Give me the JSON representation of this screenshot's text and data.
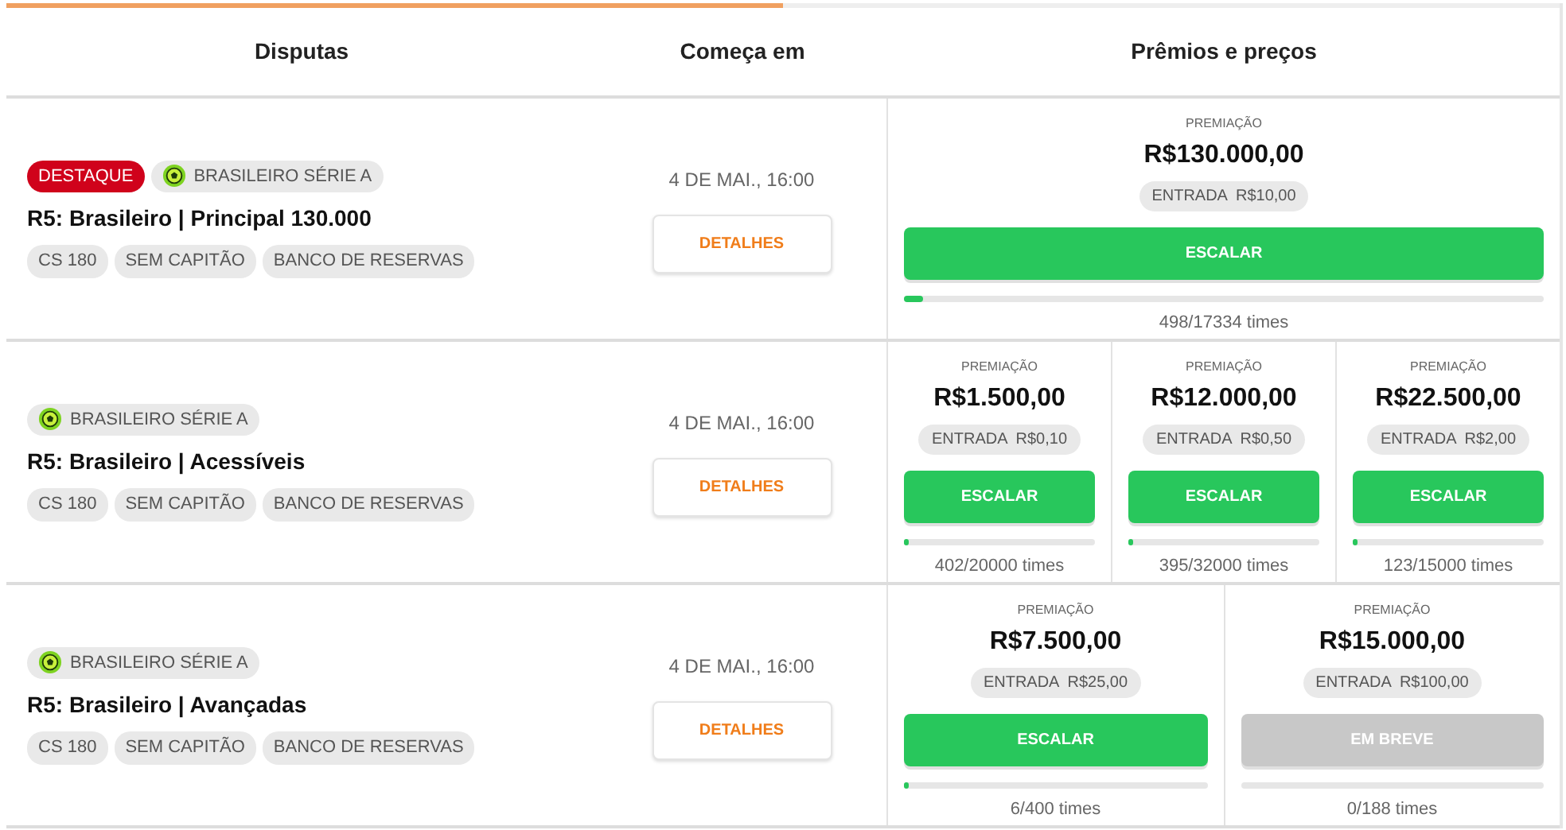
{
  "loading_bar": {
    "level": 0.5
  },
  "columns": [
    "Disputas",
    "Começa em",
    "Prêmios e preços"
  ],
  "contests": [
    {
      "badges": [
        {
          "kind": "highlight",
          "label": "DESTAQUE"
        },
        {
          "kind": "league",
          "label": "BRASILEIRO SÉRIE A"
        }
      ],
      "title": "R5: Brasileiro | Principal 130.000",
      "rules": [
        "CS 180",
        "SEM CAPITÃO",
        "BANCO DE RESERVAS"
      ],
      "start": "4 DE MAI., 16:00",
      "details": "DETALHES",
      "prizes": [
        {
          "caption": "PREMIAÇÃO",
          "amount": "R$130.000,00",
          "entry_label": "ENTRADA",
          "entry_value": "R$10,00",
          "kind": "open",
          "button": "ESCALAR",
          "level": 0.029,
          "teams": "498/17334 times"
        }
      ]
    },
    {
      "badges": [
        {
          "kind": "league",
          "label": "BRASILEIRO SÉRIE A"
        }
      ],
      "title": "R5: Brasileiro | Acessíveis",
      "rules": [
        "CS 180",
        "SEM CAPITÃO",
        "BANCO DE RESERVAS"
      ],
      "start": "4 DE MAI., 16:00",
      "details": "DETALHES",
      "prizes": [
        {
          "caption": "PREMIAÇÃO",
          "amount": "R$1.500,00",
          "entry_label": "ENTRADA",
          "entry_value": "R$0,10",
          "kind": "open",
          "button": "ESCALAR",
          "level": 0.02,
          "teams": "402/20000 times"
        },
        {
          "caption": "PREMIAÇÃO",
          "amount": "R$12.000,00",
          "entry_label": "ENTRADA",
          "entry_value": "R$0,50",
          "kind": "open",
          "button": "ESCALAR",
          "level": 0.012,
          "teams": "395/32000 times"
        },
        {
          "caption": "PREMIAÇÃO",
          "amount": "R$22.500,00",
          "entry_label": "ENTRADA",
          "entry_value": "R$2,00",
          "kind": "open",
          "button": "ESCALAR",
          "level": 0.008,
          "teams": "123/15000 times"
        }
      ]
    },
    {
      "badges": [
        {
          "kind": "league",
          "label": "BRASILEIRO SÉRIE A"
        }
      ],
      "title": "R5: Brasileiro | Avançadas",
      "rules": [
        "CS 180",
        "SEM CAPITÃO",
        "BANCO DE RESERVAS"
      ],
      "start": "4 DE MAI., 16:00",
      "details": "DETALHES",
      "prizes": [
        {
          "caption": "PREMIAÇÃO",
          "amount": "R$7.500,00",
          "entry_label": "ENTRADA",
          "entry_value": "R$25,00",
          "kind": "open",
          "button": "ESCALAR",
          "level": 0.015,
          "teams": "6/400 times"
        },
        {
          "caption": "PREMIAÇÃO",
          "amount": "R$15.000,00",
          "entry_label": "ENTRADA",
          "entry_value": "R$100,00",
          "kind": "soon",
          "button": "EM BREVE",
          "level": 0,
          "teams": "0/188 times"
        }
      ]
    }
  ]
}
